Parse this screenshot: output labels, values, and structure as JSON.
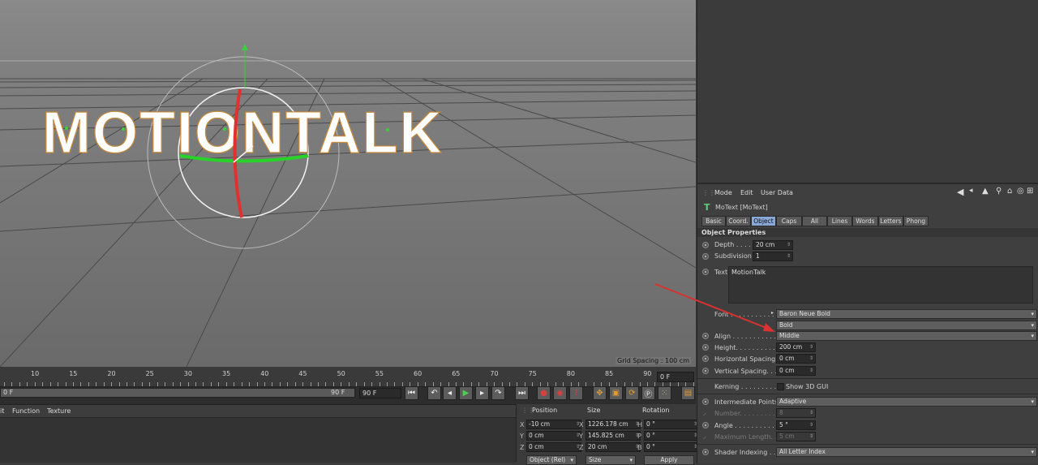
{
  "viewport": {
    "logo_text": "MOTIONTALK",
    "grid_spacing": "Grid Spacing : 100 cm"
  },
  "timeline": {
    "ruler_labels": [
      "10",
      "15",
      "20",
      "25",
      "30",
      "35",
      "40",
      "45",
      "50",
      "55",
      "60",
      "65",
      "70",
      "75",
      "80",
      "85",
      "90"
    ],
    "current_frame": "0 F",
    "range_start": "0 F",
    "range_end": "90 F",
    "end_field": "90 F",
    "colors": {
      "record": "#d94040",
      "play": "#4fcf4f",
      "tool": "#e39a2e"
    }
  },
  "lower_menu": {
    "items": [
      "it",
      "Function",
      "Texture"
    ]
  },
  "coords": {
    "headers": {
      "position": "Position",
      "size": "Size",
      "rotation": "Rotation"
    },
    "rows": [
      {
        "axis": "X",
        "pos": "-10 cm",
        "size_axis": "X",
        "size": "1226.178 cm",
        "rot_axis": "H",
        "rot": "0 °"
      },
      {
        "axis": "Y",
        "pos": "0 cm",
        "size_axis": "Y",
        "size": "145.825 cm",
        "rot_axis": "P",
        "rot": "0 °"
      },
      {
        "axis": "Z",
        "pos": "0 cm",
        "size_axis": "Z",
        "size": "20 cm",
        "rot_axis": "B",
        "rot": "0 °"
      }
    ],
    "mode_select": "Object (Rel)",
    "size_select": "Size",
    "apply_label": "Apply"
  },
  "attributes": {
    "menu": [
      "Mode",
      "Edit",
      "User Data"
    ],
    "object_name": "MoText [MoText]",
    "tabs": [
      "Basic",
      "Coord.",
      "Object",
      "Caps",
      "All",
      "Lines",
      "Words",
      "Letters",
      "Phong"
    ],
    "active_tab": "Object",
    "section_title": "Object Properties",
    "depth_label": "Depth . . . . .",
    "depth_value": "20 cm",
    "subdivision_label": "Subdivision",
    "subdivision_value": "1",
    "text_label": "Text",
    "text_value": "MotionTalk",
    "font_label": "Font . . . . . . . . . . .",
    "font_value": "Baron Neue Bold",
    "font_style": "Bold",
    "align_label": "Align . . . . . . . . . . .",
    "align_value": "Middle",
    "height_label": "Height. . . . . . . . . .",
    "height_value": "200 cm",
    "hspacing_label": "Horizontal Spacing",
    "hspacing_value": "0 cm",
    "vspacing_label": "Vertical Spacing. . .",
    "vspacing_value": "0 cm",
    "kerning_label": "Kerning . . . . . . . . .",
    "show3d_label": "Show 3D GUI",
    "interp_label": "Intermediate Points",
    "interp_value": "Adaptive",
    "number_label": "Number. . . . . . . . . .",
    "number_value": "8",
    "angle_label": "Angle . . . . . . . . . . .",
    "angle_value": "5 °",
    "maxlen_label": "Maximum Length. . .",
    "maxlen_value": "5 cm",
    "shader_label": "Shader Indexing . . .",
    "shader_value": "All Letter Index",
    "accent_color": "#8aa8d8",
    "motext_icon_color": "#5ccf7a"
  }
}
